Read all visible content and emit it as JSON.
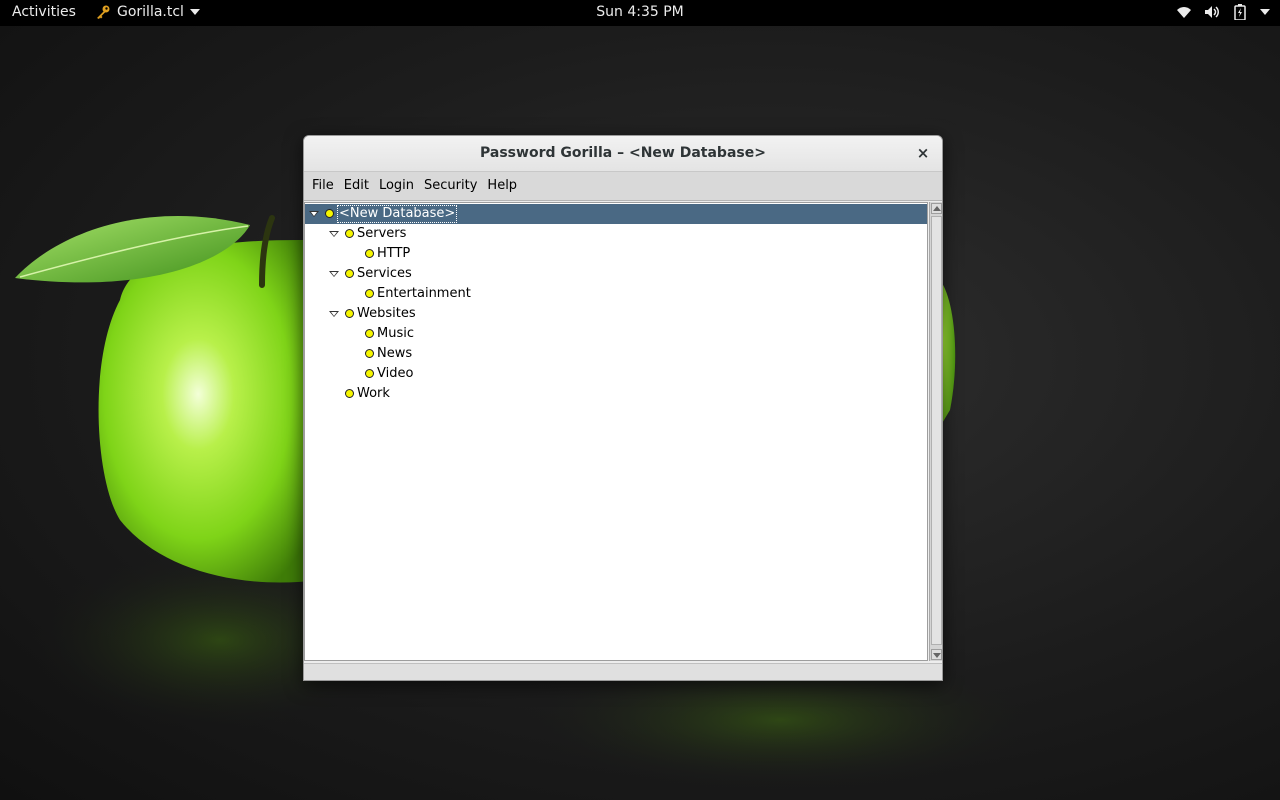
{
  "topbar": {
    "activities": "Activities",
    "app_name": "Gorilla.tcl",
    "app_icon": "key-icon",
    "clock": "Sun  4:35 PM",
    "tray": [
      "wifi-icon",
      "volume-icon",
      "battery-icon",
      "system-menu-caret"
    ]
  },
  "window": {
    "title": "Password Gorilla – <New Database>",
    "close": "×",
    "menu": [
      "File",
      "Edit",
      "Login",
      "Security",
      "Help"
    ]
  },
  "tree": [
    {
      "label": "<New Database>",
      "level": 0,
      "expanded": true,
      "selected": true
    },
    {
      "label": "Servers",
      "level": 1,
      "expanded": true
    },
    {
      "label": "HTTP",
      "level": 2
    },
    {
      "label": "Services",
      "level": 1,
      "expanded": true
    },
    {
      "label": "Entertainment",
      "level": 2
    },
    {
      "label": "Websites",
      "level": 1,
      "expanded": true
    },
    {
      "label": "Music",
      "level": 2
    },
    {
      "label": "News",
      "level": 2
    },
    {
      "label": "Video",
      "level": 2
    },
    {
      "label": "Work",
      "level": 1
    }
  ],
  "colors": {
    "selection": "#4a6984",
    "node_dot": "#f6f600",
    "wallpaper_accent": "#8ee21a"
  }
}
